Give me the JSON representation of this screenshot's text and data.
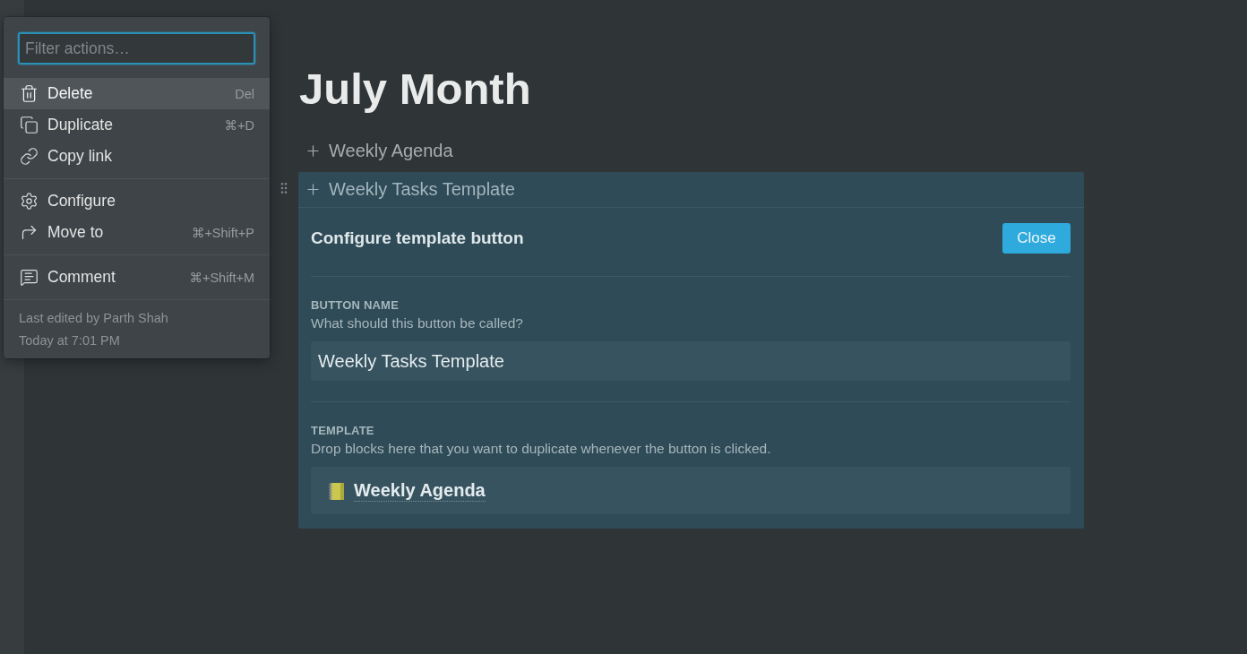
{
  "action_menu": {
    "filter": {
      "placeholder": "Filter actions…",
      "focused": true
    },
    "sections": [
      {
        "items": [
          {
            "label": "Delete",
            "shortcut": "Del",
            "selected": true
          },
          {
            "label": "Duplicate",
            "shortcut": "⌘+D",
            "selected": false
          },
          {
            "label": "Copy link",
            "selected": false
          }
        ]
      },
      {
        "items": [
          {
            "label": "Configure",
            "selected": false
          },
          {
            "label": "Move to",
            "shortcut": "⌘+Shift+P",
            "selected": false
          }
        ]
      },
      {
        "items": [
          {
            "label": "Comment",
            "shortcut": "⌘+Shift+M",
            "selected": false
          }
        ]
      }
    ],
    "footer": [
      "Last edited by Parth Shah",
      "Today at 7:01 PM"
    ]
  },
  "page": {
    "title": "July Month",
    "blocks": [
      {
        "label": "Weekly Agenda",
        "selected": false
      },
      {
        "label": "Weekly Tasks Template",
        "selected": true,
        "config": {
          "title": "Configure template button",
          "close_button": "Close",
          "button_name": {
            "label": "BUTTON NAME",
            "description": "What should this button be called?",
            "value": "Weekly Tasks Template"
          },
          "template": {
            "label": "TEMPLATE",
            "description": "Drop blocks here that you want to duplicate whenever the button is clicked.",
            "items": [
              {
                "title": "Weekly Agenda"
              }
            ]
          }
        }
      }
    ]
  }
}
